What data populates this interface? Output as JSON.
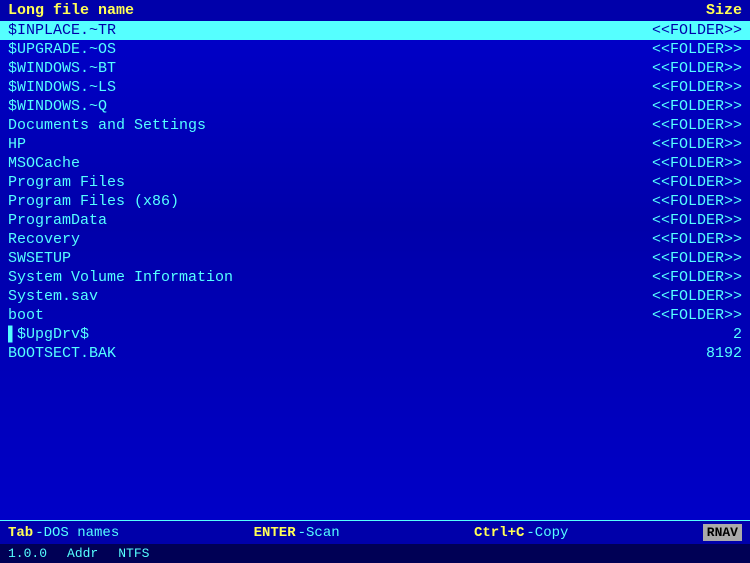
{
  "header": {
    "name_col": "Long file name",
    "size_col": "Size"
  },
  "files": [
    {
      "name": "$INPLACE.~TR",
      "size": "<<FOLDER>>",
      "selected": true
    },
    {
      "name": "$UPGRADE.~OS",
      "size": "<<FOLDER>>",
      "selected": false
    },
    {
      "name": "$WINDOWS.~BT",
      "size": "<<FOLDER>>",
      "selected": false
    },
    {
      "name": "$WINDOWS.~LS",
      "size": "<<FOLDER>>",
      "selected": false
    },
    {
      "name": "$WINDOWS.~Q",
      "size": "<<FOLDER>>",
      "selected": false
    },
    {
      "name": "Documents and Settings",
      "size": "<<FOLDER>>",
      "selected": false
    },
    {
      "name": "HP",
      "size": "<<FOLDER>>",
      "selected": false
    },
    {
      "name": "MSOCache",
      "size": "<<FOLDER>>",
      "selected": false
    },
    {
      "name": "Program Files",
      "size": "<<FOLDER>>",
      "selected": false
    },
    {
      "name": "Program Files (x86)",
      "size": "<<FOLDER>>",
      "selected": false
    },
    {
      "name": "ProgramData",
      "size": "<<FOLDER>>",
      "selected": false
    },
    {
      "name": "Recovery",
      "size": "<<FOLDER>>",
      "selected": false
    },
    {
      "name": "SWSETUP",
      "size": "<<FOLDER>>",
      "selected": false
    },
    {
      "name": "System Volume Information",
      "size": "<<FOLDER>>",
      "selected": false
    },
    {
      "name": "System.sav",
      "size": "<<FOLDER>>",
      "selected": false
    },
    {
      "name": "boot",
      "size": "<<FOLDER>>",
      "selected": false
    },
    {
      "name": "▌$UpgDrv$",
      "size": "2",
      "selected": false,
      "numeric": true
    },
    {
      "name": "BOOTSECT.BAK",
      "size": "8192",
      "selected": false,
      "numeric": true
    }
  ],
  "footer": {
    "tab_label": "Tab",
    "tab_desc": "-DOS names",
    "enter_label": "ENTER",
    "enter_desc": "-Scan",
    "ctrl_label": "Ctrl+C",
    "ctrl_desc": "-Copy",
    "rnav": "RNAV"
  },
  "statusbar": {
    "version": "1.0.0",
    "addr_label": "Addr",
    "fs_label": "NTFS"
  }
}
